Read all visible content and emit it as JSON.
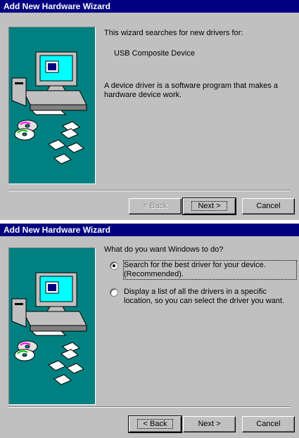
{
  "colors": {
    "titlebar": "#000080",
    "dialog": "#c0c0c0",
    "art_background": "#008080"
  },
  "dialog1": {
    "title": "Add New Hardware Wizard",
    "line1": "This wizard searches for new drivers for:",
    "device": "USB Composite Device",
    "description": "A device driver is a software program that makes a\nhardware device work.",
    "buttons": {
      "back": "< Back",
      "back_enabled": false,
      "next": "Next >",
      "cancel": "Cancel"
    }
  },
  "dialog2": {
    "title": "Add New Hardware Wizard",
    "question": "What do you want Windows to do?",
    "options": [
      {
        "label": "Search for the best driver for your device.\n(Recommended).",
        "selected": true
      },
      {
        "label": "Display a list of all the drivers in a specific\nlocation, so you can select the driver you want.",
        "selected": false
      }
    ],
    "buttons": {
      "back": "< Back",
      "back_enabled": true,
      "next": "Next >",
      "cancel": "Cancel"
    }
  },
  "art_icons": [
    "computer-icon",
    "cd-icon",
    "floppy-disk-icon"
  ]
}
